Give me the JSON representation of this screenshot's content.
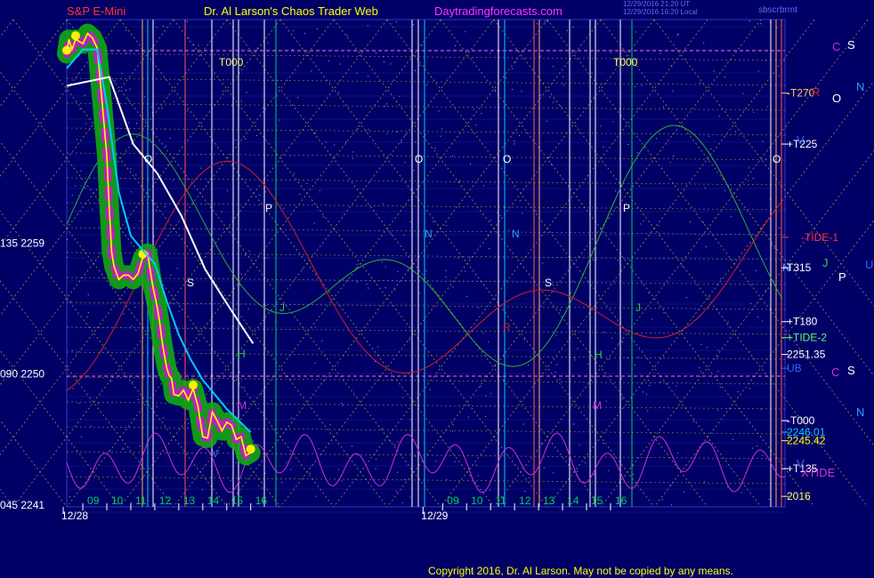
{
  "header": {
    "symbol": "S&P E-Mini",
    "author": "Dr. Al Larson's Chaos Trader Web",
    "site": "Daytradingforecasts.com",
    "timestamp1": "12/29/2016 21:20 UT",
    "timestamp2": "12/29/2016 16:20 Local",
    "user": "sbscrbrmt"
  },
  "footer": {
    "copyright": "Copyright 2016, Dr. Al Larson. May not be copied by any means."
  },
  "colors": {
    "background": "#000066",
    "price_line": "#ffff00",
    "moving_avg_fast": "#00ccff",
    "moving_avg_slow": "#ffffff",
    "xtide": "#cc33cc",
    "tide_green": "#33aa33",
    "tide_red": "#cc2222",
    "grid": "#3333cc",
    "field_lines": "#cccc33"
  },
  "chart_data": {
    "type": "line",
    "ylim": [
      2241,
      2274
    ],
    "y_ticks": [
      {
        "value": 2241,
        "label": "045  2241"
      },
      {
        "value": 2250,
        "label": "090  2250"
      },
      {
        "value": 2259,
        "label": "135  2259"
      }
    ],
    "x_ticks": [
      "09",
      "10",
      "11",
      "12",
      "13",
      "14",
      "15",
      "16",
      "09",
      "10",
      "11",
      "12",
      "13",
      "14",
      "15",
      "16"
    ],
    "x_hour_positions": [
      9,
      10,
      11,
      12,
      13,
      14,
      15,
      16,
      24,
      25,
      26,
      27,
      28,
      29,
      30,
      31
    ],
    "dates": [
      {
        "label": "12/28",
        "x": 9
      },
      {
        "label": "12/29",
        "x": 24
      }
    ],
    "x_range": [
      8.3,
      37.5
    ],
    "series": [
      {
        "x": [
          8.33,
          8.42,
          8.55,
          8.7,
          9.0,
          9.2,
          9.4,
          9.6,
          9.8,
          10.0,
          10.1,
          10.2,
          10.3,
          10.5,
          10.7,
          10.9,
          11.1,
          11.3,
          11.5,
          11.7,
          11.9,
          12.0,
          12.1,
          12.2,
          12.3,
          12.4,
          12.5,
          12.6,
          12.7,
          12.8,
          13.0,
          13.2,
          13.4,
          13.6,
          13.8,
          14.0,
          14.2,
          14.4,
          14.6,
          14.8,
          15.0,
          15.2,
          15.4,
          15.6,
          15.8,
          16.0
        ],
        "values": [
          2272,
          2273,
          2272.3,
          2273,
          2272.7,
          2273.4,
          2273.1,
          2272.4,
          2268.8,
          2265,
          2261.5,
          2258.4,
          2257.4,
          2256.5,
          2256.8,
          2256.8,
          2256.5,
          2256.9,
          2258,
          2258.3,
          2256.2,
          2255.4,
          2254.6,
          2253.6,
          2252.3,
          2251.3,
          2250.4,
          2249.9,
          2249.7,
          2248.6,
          2248.5,
          2248.9,
          2248.2,
          2249,
          2247.8,
          2245.7,
          2245.6,
          2247.4,
          2246.8,
          2246.1,
          2246.7,
          2246.5,
          2245.5,
          2245.7,
          2244.4,
          2244.6
        ]
      },
      {
        "name": "",
        "x": [
          8.33,
          9.0,
          9.6,
          10.0,
          10.5,
          11.0,
          11.5,
          12.0,
          12.5,
          13.0,
          13.5,
          14.0,
          14.5,
          15.0,
          15.5,
          16.0
        ],
        "values": [
          2271,
          2272.3,
          2272.3,
          2268.5,
          2262.5,
          2259.5,
          2258.5,
          2257.6,
          2255,
          2252.7,
          2251,
          2249.6,
          2248.6,
          2247.6,
          2246.8,
          2246.0
        ]
      },
      {
        "name": "",
        "x": [
          8.33,
          10.1,
          11.1,
          12.1,
          13.1,
          14.1,
          15.1,
          16.1
        ],
        "values": [
          2269.8,
          2270.4,
          2265.8,
          2263.8,
          2260.9,
          2257.2,
          2254.6,
          2252.1
        ]
      }
    ],
    "horizontal_levels": [
      {
        "label": "-T270",
        "value": 2269.3,
        "color": "#ffcc66"
      },
      {
        "label": "+T225",
        "value": 2265.8,
        "color": "#ffffff"
      },
      {
        "label": "-TIDE-1",
        "value": 2259.4,
        "color": "#ff3333"
      },
      {
        "label": "N",
        "value": 2257.3,
        "color": "#6699ff"
      },
      {
        "label": "T315",
        "value": 2257.3,
        "color": "#ffffff"
      },
      {
        "label": "+T180",
        "value": 2253.6,
        "color": "#ffffff"
      },
      {
        "label": "+TIDE-2",
        "value": 2252.5,
        "color": "#66ff66"
      },
      {
        "label": "2251.35",
        "value": 2251.35,
        "color": "#ffffff"
      },
      {
        "label": "UB",
        "value": 2250.4,
        "color": "#3366ff"
      },
      {
        "label": "-T000",
        "value": 2246.8,
        "color": "#ffffff"
      },
      {
        "label": "2246.01",
        "value": 2246.01,
        "color": "#00ccff"
      },
      {
        "label": "2245.42",
        "value": 2245.42,
        "color": "#ffff00"
      },
      {
        "label": "+T135",
        "value": 2243.5,
        "color": "#ffffff"
      },
      {
        "label": "2016",
        "value": 2241.6,
        "color": "#ffff66"
      }
    ],
    "right_letters": [
      {
        "t": "C",
        "x": 935,
        "y": 57,
        "color": "#cc33cc"
      },
      {
        "t": "S",
        "x": 952,
        "y": 55,
        "color": "#ffffff"
      },
      {
        "t": "N",
        "x": 962,
        "y": 102,
        "color": "#3399ff"
      },
      {
        "t": "R",
        "x": 912,
        "y": 108,
        "color": "#cc2222"
      },
      {
        "t": "O",
        "x": 935,
        "y": 115,
        "color": "#ffffff"
      },
      {
        "t": "V",
        "x": 895,
        "y": 162,
        "color": "#3366ff"
      },
      {
        "t": "J",
        "x": 924,
        "y": 300,
        "color": "#33cc33"
      },
      {
        "t": "U",
        "x": 972,
        "y": 302,
        "color": "#3366ff"
      },
      {
        "t": "P",
        "x": 942,
        "y": 316,
        "color": "#ffffff"
      },
      {
        "t": "C",
        "x": 934,
        "y": 423,
        "color": "#cc33cc"
      },
      {
        "t": "S",
        "x": 952,
        "y": 421,
        "color": "#ffffff"
      },
      {
        "t": "N",
        "x": 962,
        "y": 468,
        "color": "#3399ff"
      },
      {
        "t": "V",
        "x": 895,
        "y": 526,
        "color": "#3366ff"
      },
      {
        "t": "XTIDE",
        "x": 900,
        "y": 536,
        "color": "#cc33cc"
      }
    ],
    "chart_letters": [
      {
        "t": "T000",
        "x": 246,
        "y": 74,
        "color": "#ffff66"
      },
      {
        "t": "T000",
        "x": 689,
        "y": 74,
        "color": "#ffff66"
      },
      {
        "t": "O",
        "x": 162,
        "y": 183,
        "color": "#ffffff"
      },
      {
        "t": "O",
        "x": 466,
        "y": 183,
        "color": "#ffffff"
      },
      {
        "t": "O",
        "x": 565,
        "y": 183,
        "color": "#ffffff"
      },
      {
        "t": "O",
        "x": 868,
        "y": 183,
        "color": "#ffffff"
      },
      {
        "t": "P",
        "x": 298,
        "y": 238,
        "color": "#ffffff"
      },
      {
        "t": "P",
        "x": 700,
        "y": 238,
        "color": "#ffffff"
      },
      {
        "t": "N",
        "x": 477,
        "y": 267,
        "color": "#3399ff"
      },
      {
        "t": "N",
        "x": 575,
        "y": 267,
        "color": "#3399ff"
      },
      {
        "t": "S",
        "x": 210,
        "y": 322,
        "color": "#ffffff"
      },
      {
        "t": "S",
        "x": 612,
        "y": 322,
        "color": "#ffffff"
      },
      {
        "t": "J",
        "x": 314,
        "y": 350,
        "color": "#33cc33"
      },
      {
        "t": "J",
        "x": 714,
        "y": 350,
        "color": "#33cc33"
      },
      {
        "t": "R",
        "x": 565,
        "y": 372,
        "color": "#cc2222"
      },
      {
        "t": "H",
        "x": 267,
        "y": 402,
        "color": "#33cc33"
      },
      {
        "t": "H",
        "x": 668,
        "y": 403,
        "color": "#33cc33"
      },
      {
        "t": "M",
        "x": 267,
        "y": 460,
        "color": "#cc33cc"
      },
      {
        "t": "M",
        "x": 666,
        "y": 460,
        "color": "#cc33cc"
      },
      {
        "t": "V",
        "x": 238,
        "y": 514,
        "color": "#3366ff"
      }
    ]
  }
}
